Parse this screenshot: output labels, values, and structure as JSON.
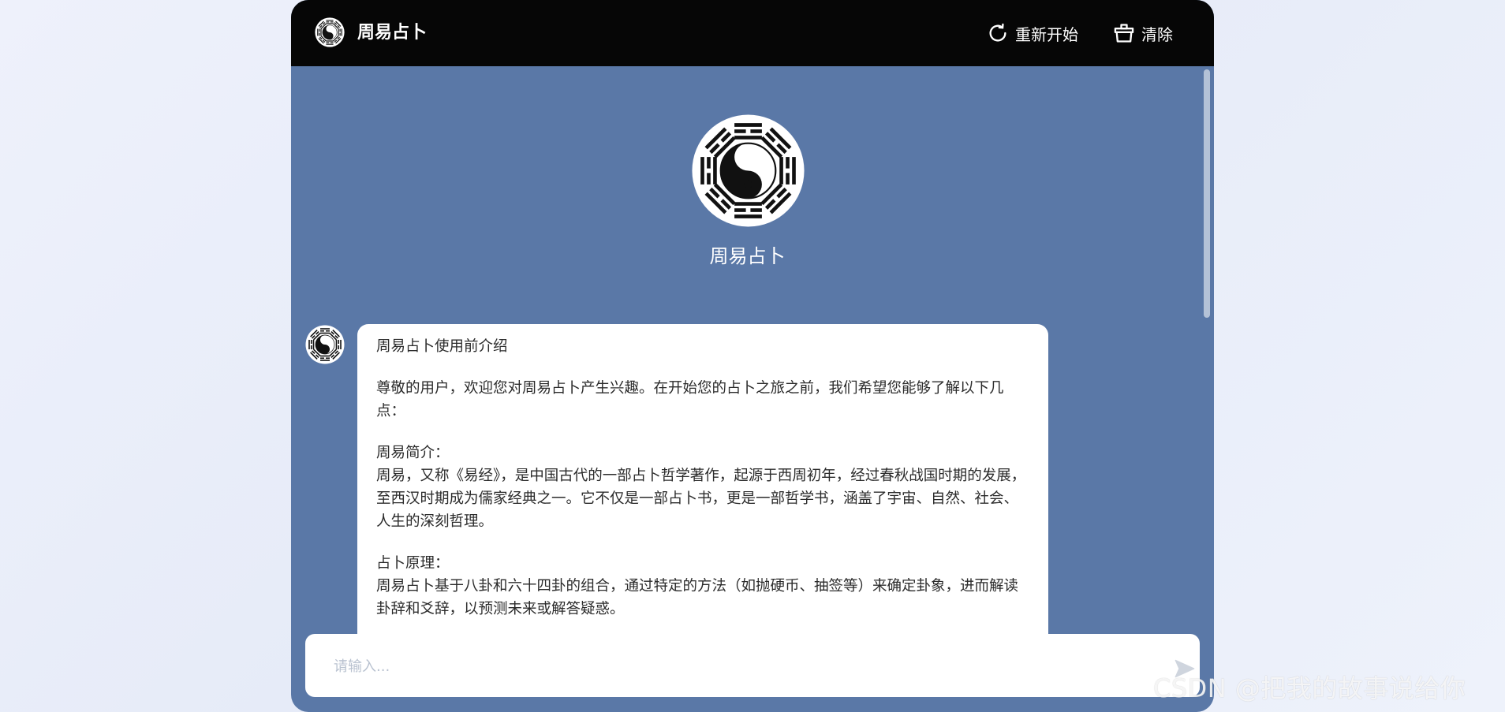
{
  "header": {
    "title": "周易占卜",
    "restart_label": "重新开始",
    "clear_label": "清除"
  },
  "hero": {
    "name": "周易占卜"
  },
  "message": {
    "title": "周易占卜使用前介绍",
    "intro": "尊敬的用户，欢迎您对周易占卜产生兴趣。在开始您的占卜之旅之前，我们希望您能够了解以下几点：",
    "section1_heading": "周易简介：",
    "section1_body": "周易，又称《易经》，是中国古代的一部占卜哲学著作，起源于西周初年，经过春秋战国时期的发展，至西汉时期成为儒家经典之一。它不仅是一部占卜书，更是一部哲学书，涵盖了宇宙、自然、社会、人生的深刻哲理。",
    "section2_heading": "占卜原理：",
    "section2_body": "周易占卜基于八卦和六十四卦的组合，通过特定的方法（如抛硬币、抽签等）来确定卦象，进而解读卦辞和爻辞，以预测未来或解答疑惑。"
  },
  "input": {
    "placeholder": "请输入..."
  },
  "watermark": "CSDN @把我的故事说给你",
  "colors": {
    "header_bg": "#060606",
    "panel_bg": "#5a78a7",
    "bubble_bg": "#ffffff"
  },
  "icons": [
    "yin-yang-bagua-icon",
    "refresh-icon",
    "basket-icon",
    "send-icon"
  ]
}
